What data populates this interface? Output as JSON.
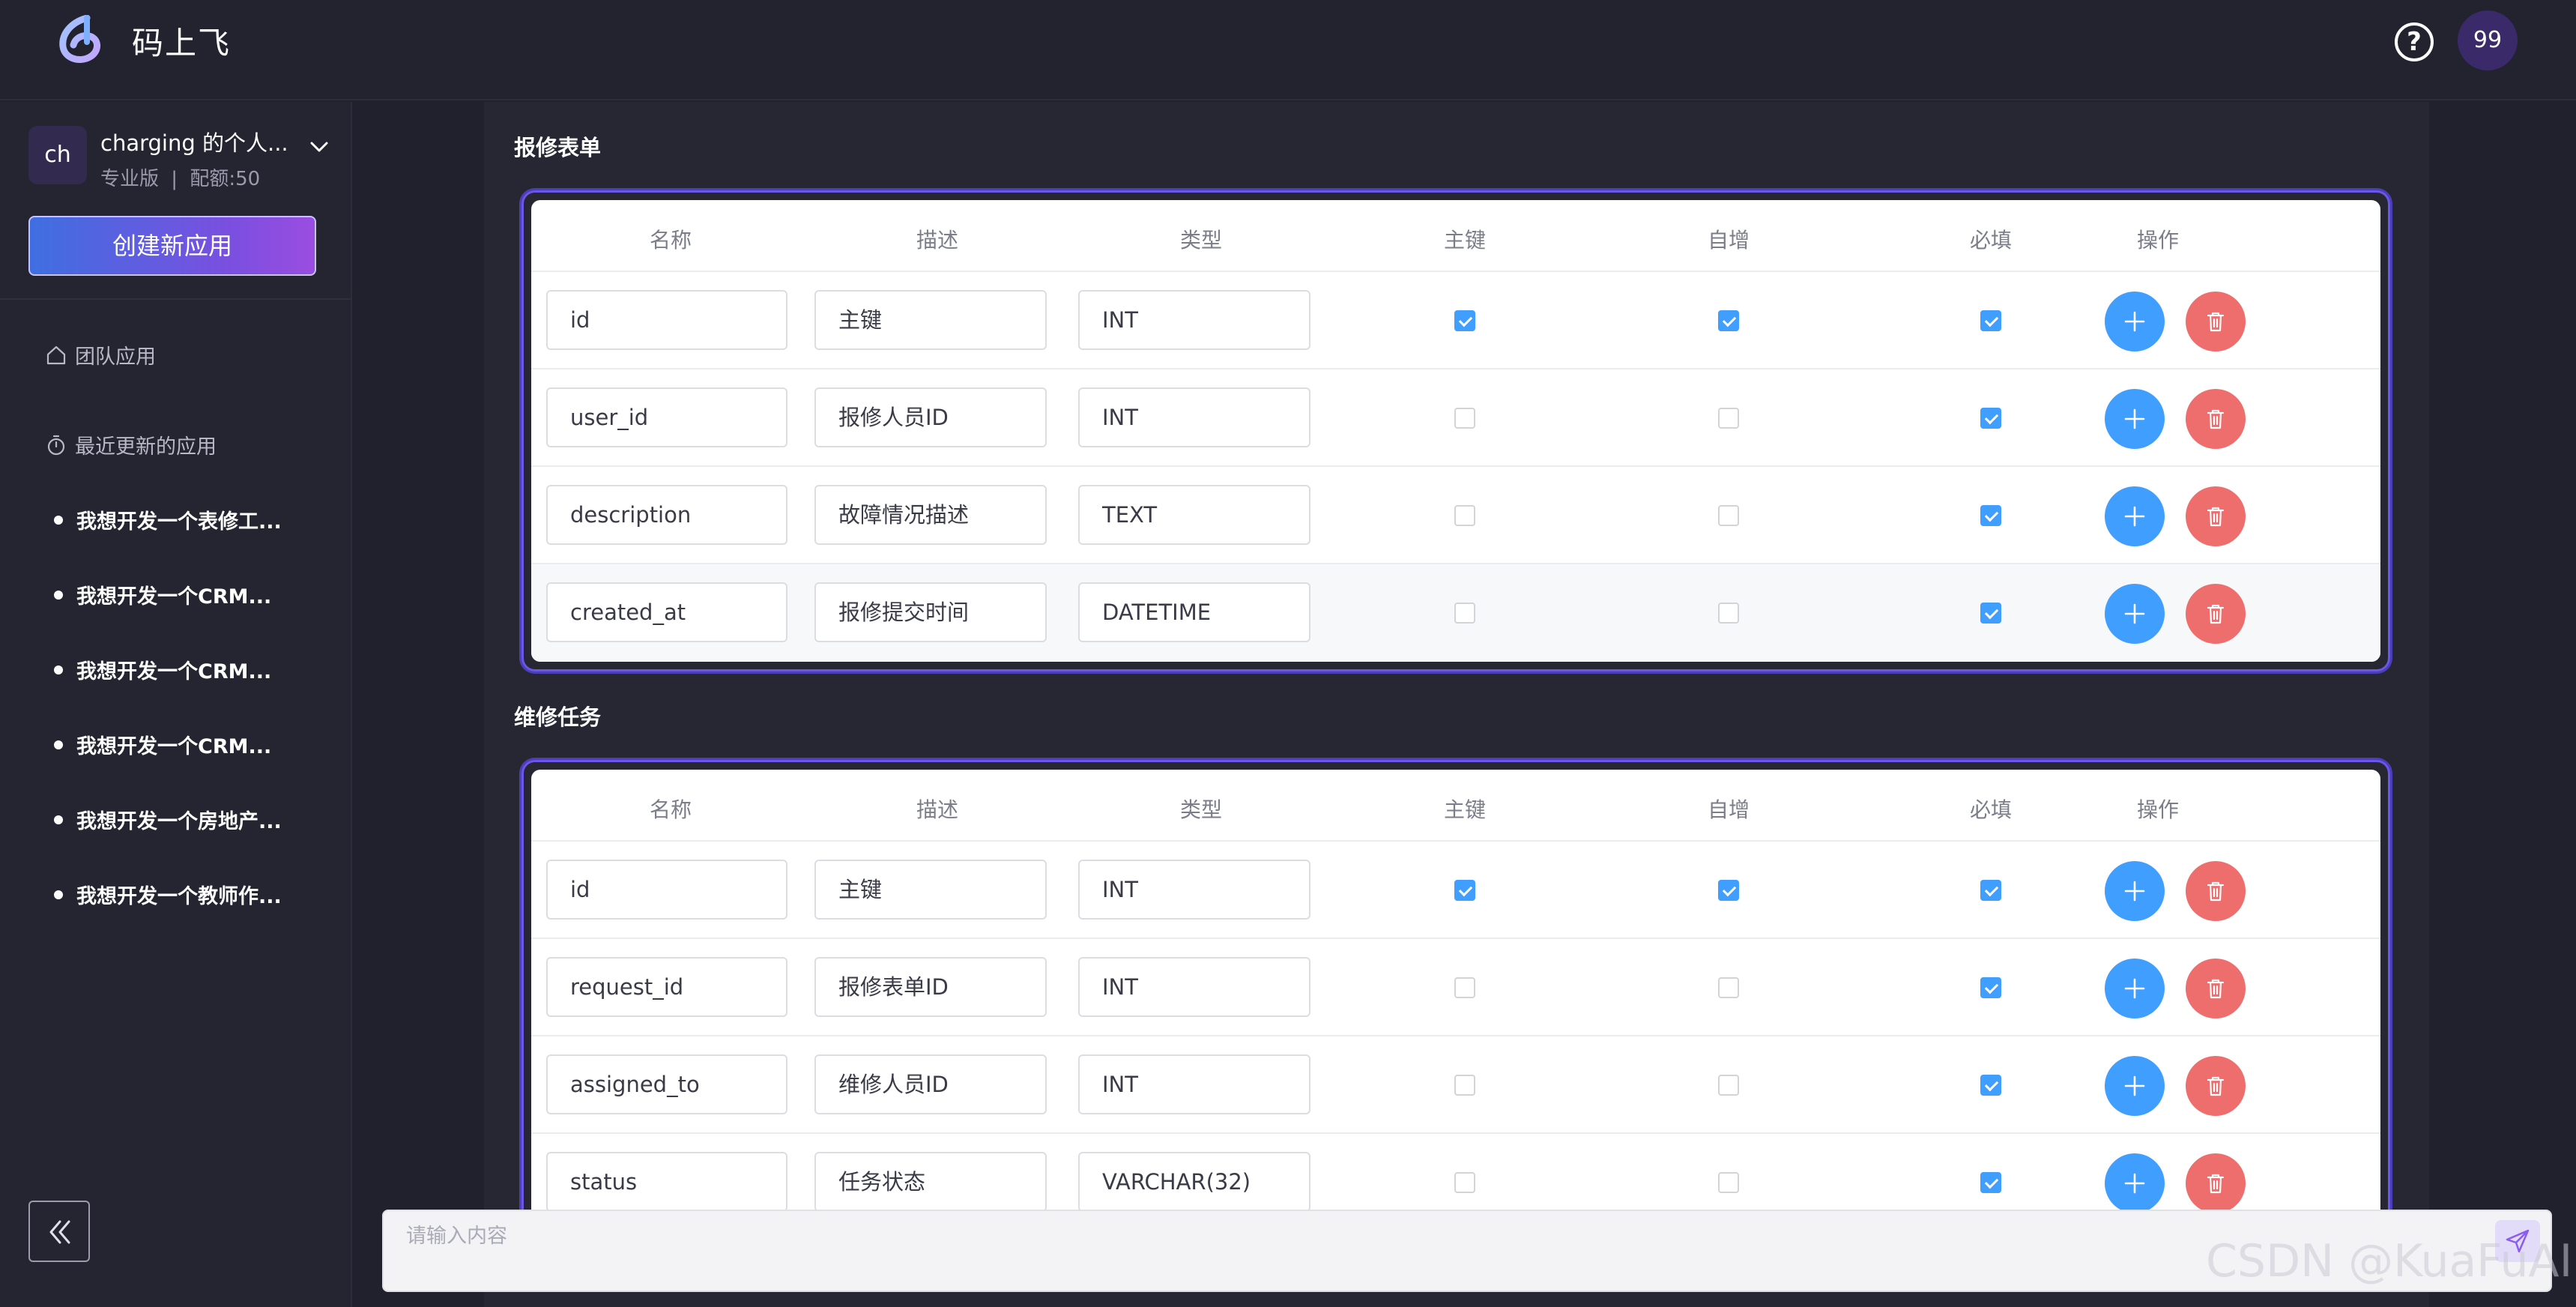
{
  "header": {
    "app_title": "码上飞",
    "help_symbol": "?",
    "user_avatar": "99"
  },
  "workspace": {
    "avatar": "ch",
    "name": "charging 的个人...",
    "plan": "专业版",
    "separator": "|",
    "quota": "配额:50"
  },
  "sidebar": {
    "create_label": "创建新应用",
    "team_apps_label": "团队应用",
    "recent_label": "最近更新的应用",
    "recent_items": [
      "我想开发一个表修工...",
      "我想开发一个CRM...",
      "我想开发一个CRM...",
      "我想开发一个CRM...",
      "我想开发一个房地产...",
      "我想开发一个教师作..."
    ]
  },
  "columns": [
    "名称",
    "描述",
    "类型",
    "主键",
    "自增",
    "必填",
    "操作"
  ],
  "tables": [
    {
      "title": "报修表单",
      "rows": [
        {
          "name": "id",
          "desc": "主键",
          "type": "INT",
          "pk": true,
          "ai": true,
          "req": true
        },
        {
          "name": "user_id",
          "desc": "报修人员ID",
          "type": "INT",
          "pk": false,
          "ai": false,
          "req": true
        },
        {
          "name": "description",
          "desc": "故障情况描述",
          "type": "TEXT",
          "pk": false,
          "ai": false,
          "req": true
        },
        {
          "name": "created_at",
          "desc": "报修提交时间",
          "type": "DATETIME",
          "pk": false,
          "ai": false,
          "req": true
        }
      ]
    },
    {
      "title": "维修任务",
      "rows": [
        {
          "name": "id",
          "desc": "主键",
          "type": "INT",
          "pk": true,
          "ai": true,
          "req": true
        },
        {
          "name": "request_id",
          "desc": "报修表单ID",
          "type": "INT",
          "pk": false,
          "ai": false,
          "req": true
        },
        {
          "name": "assigned_to",
          "desc": "维修人员ID",
          "type": "INT",
          "pk": false,
          "ai": false,
          "req": true
        },
        {
          "name": "status",
          "desc": "任务状态",
          "type": "VARCHAR(32)",
          "pk": false,
          "ai": false,
          "req": true
        }
      ]
    }
  ],
  "chat": {
    "placeholder": "请输入内容"
  },
  "watermark": "CSDN @KuaFuAI",
  "colors": {
    "accent": "#409eff",
    "danger": "#ee6e6e",
    "frame": "#6a56e8",
    "background": "#20212c"
  }
}
